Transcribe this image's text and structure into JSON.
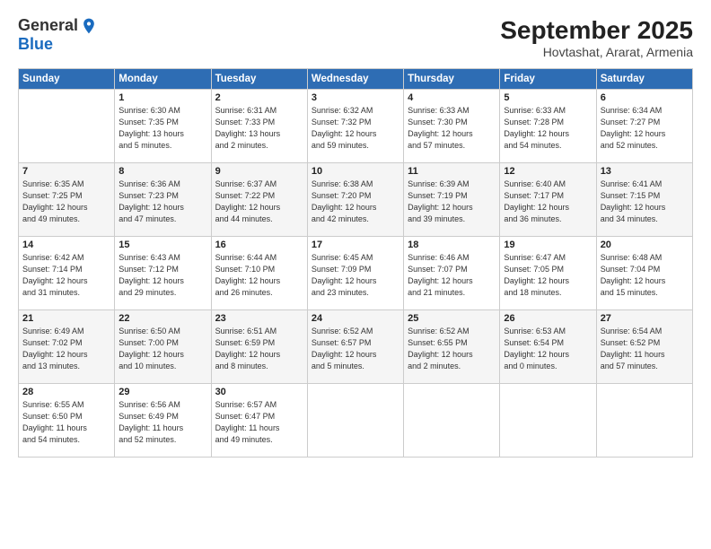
{
  "logo": {
    "general": "General",
    "blue": "Blue"
  },
  "header": {
    "month": "September 2025",
    "location": "Hovtashat, Ararat, Armenia"
  },
  "weekdays": [
    "Sunday",
    "Monday",
    "Tuesday",
    "Wednesday",
    "Thursday",
    "Friday",
    "Saturday"
  ],
  "weeks": [
    [
      {
        "day": "",
        "info": ""
      },
      {
        "day": "1",
        "info": "Sunrise: 6:30 AM\nSunset: 7:35 PM\nDaylight: 13 hours\nand 5 minutes."
      },
      {
        "day": "2",
        "info": "Sunrise: 6:31 AM\nSunset: 7:33 PM\nDaylight: 13 hours\nand 2 minutes."
      },
      {
        "day": "3",
        "info": "Sunrise: 6:32 AM\nSunset: 7:32 PM\nDaylight: 12 hours\nand 59 minutes."
      },
      {
        "day": "4",
        "info": "Sunrise: 6:33 AM\nSunset: 7:30 PM\nDaylight: 12 hours\nand 57 minutes."
      },
      {
        "day": "5",
        "info": "Sunrise: 6:33 AM\nSunset: 7:28 PM\nDaylight: 12 hours\nand 54 minutes."
      },
      {
        "day": "6",
        "info": "Sunrise: 6:34 AM\nSunset: 7:27 PM\nDaylight: 12 hours\nand 52 minutes."
      }
    ],
    [
      {
        "day": "7",
        "info": "Sunrise: 6:35 AM\nSunset: 7:25 PM\nDaylight: 12 hours\nand 49 minutes."
      },
      {
        "day": "8",
        "info": "Sunrise: 6:36 AM\nSunset: 7:23 PM\nDaylight: 12 hours\nand 47 minutes."
      },
      {
        "day": "9",
        "info": "Sunrise: 6:37 AM\nSunset: 7:22 PM\nDaylight: 12 hours\nand 44 minutes."
      },
      {
        "day": "10",
        "info": "Sunrise: 6:38 AM\nSunset: 7:20 PM\nDaylight: 12 hours\nand 42 minutes."
      },
      {
        "day": "11",
        "info": "Sunrise: 6:39 AM\nSunset: 7:19 PM\nDaylight: 12 hours\nand 39 minutes."
      },
      {
        "day": "12",
        "info": "Sunrise: 6:40 AM\nSunset: 7:17 PM\nDaylight: 12 hours\nand 36 minutes."
      },
      {
        "day": "13",
        "info": "Sunrise: 6:41 AM\nSunset: 7:15 PM\nDaylight: 12 hours\nand 34 minutes."
      }
    ],
    [
      {
        "day": "14",
        "info": "Sunrise: 6:42 AM\nSunset: 7:14 PM\nDaylight: 12 hours\nand 31 minutes."
      },
      {
        "day": "15",
        "info": "Sunrise: 6:43 AM\nSunset: 7:12 PM\nDaylight: 12 hours\nand 29 minutes."
      },
      {
        "day": "16",
        "info": "Sunrise: 6:44 AM\nSunset: 7:10 PM\nDaylight: 12 hours\nand 26 minutes."
      },
      {
        "day": "17",
        "info": "Sunrise: 6:45 AM\nSunset: 7:09 PM\nDaylight: 12 hours\nand 23 minutes."
      },
      {
        "day": "18",
        "info": "Sunrise: 6:46 AM\nSunset: 7:07 PM\nDaylight: 12 hours\nand 21 minutes."
      },
      {
        "day": "19",
        "info": "Sunrise: 6:47 AM\nSunset: 7:05 PM\nDaylight: 12 hours\nand 18 minutes."
      },
      {
        "day": "20",
        "info": "Sunrise: 6:48 AM\nSunset: 7:04 PM\nDaylight: 12 hours\nand 15 minutes."
      }
    ],
    [
      {
        "day": "21",
        "info": "Sunrise: 6:49 AM\nSunset: 7:02 PM\nDaylight: 12 hours\nand 13 minutes."
      },
      {
        "day": "22",
        "info": "Sunrise: 6:50 AM\nSunset: 7:00 PM\nDaylight: 12 hours\nand 10 minutes."
      },
      {
        "day": "23",
        "info": "Sunrise: 6:51 AM\nSunset: 6:59 PM\nDaylight: 12 hours\nand 8 minutes."
      },
      {
        "day": "24",
        "info": "Sunrise: 6:52 AM\nSunset: 6:57 PM\nDaylight: 12 hours\nand 5 minutes."
      },
      {
        "day": "25",
        "info": "Sunrise: 6:52 AM\nSunset: 6:55 PM\nDaylight: 12 hours\nand 2 minutes."
      },
      {
        "day": "26",
        "info": "Sunrise: 6:53 AM\nSunset: 6:54 PM\nDaylight: 12 hours\nand 0 minutes."
      },
      {
        "day": "27",
        "info": "Sunrise: 6:54 AM\nSunset: 6:52 PM\nDaylight: 11 hours\nand 57 minutes."
      }
    ],
    [
      {
        "day": "28",
        "info": "Sunrise: 6:55 AM\nSunset: 6:50 PM\nDaylight: 11 hours\nand 54 minutes."
      },
      {
        "day": "29",
        "info": "Sunrise: 6:56 AM\nSunset: 6:49 PM\nDaylight: 11 hours\nand 52 minutes."
      },
      {
        "day": "30",
        "info": "Sunrise: 6:57 AM\nSunset: 6:47 PM\nDaylight: 11 hours\nand 49 minutes."
      },
      {
        "day": "",
        "info": ""
      },
      {
        "day": "",
        "info": ""
      },
      {
        "day": "",
        "info": ""
      },
      {
        "day": "",
        "info": ""
      }
    ]
  ]
}
